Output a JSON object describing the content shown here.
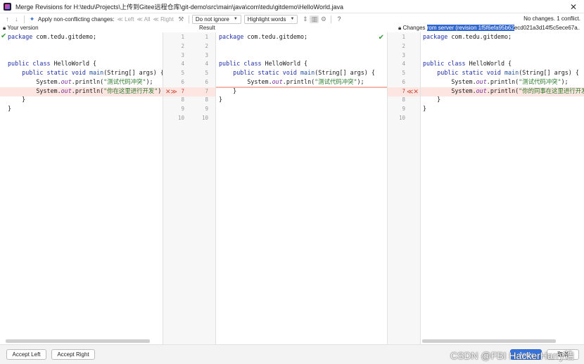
{
  "window": {
    "title": "Merge Revisions for H:\\tedu\\Projects\\上传到Gitee远程仓库\\git-demo\\src\\main\\java\\com\\tedu\\gitdemo\\HelloWorld.java",
    "app_icon": "intellij-icon",
    "close_glyph": "✕"
  },
  "toolbar": {
    "apply_nonconflicting_label": "Apply non-conflicting changes:",
    "left_label": "Left",
    "all_label": "All",
    "right_label": "Right",
    "ignore_dropdown": "Do not ignore",
    "highlight_dropdown": "Highlight words",
    "help_glyph": "?",
    "status": "No changes. 1 conflict."
  },
  "headers": {
    "left": "Your version",
    "middle": "Result",
    "right_prefix": "Changes ",
    "right_selected": "rom server (revision 1f5f6efa95b62",
    "right_rest": "ecd021a3d14f5c5ece67a..."
  },
  "line_numbers": [
    "1",
    "2",
    "3",
    "4",
    "5",
    "6",
    "7",
    "8",
    "9",
    "10"
  ],
  "code": {
    "left": [
      {
        "segs": [
          [
            "kw",
            "package"
          ],
          [
            "",
            "com.tedu.gitdemo;"
          ]
        ]
      },
      {
        "segs": []
      },
      {
        "segs": []
      },
      {
        "segs": [
          [
            "kw",
            "public"
          ],
          [
            "",
            ""
          ],
          [
            "kw",
            "class"
          ],
          [
            "",
            "HelloWorld {"
          ]
        ]
      },
      {
        "segs": [
          [
            "",
            "    "
          ],
          [
            "kw",
            "public"
          ],
          [
            "",
            ""
          ],
          [
            "kw",
            "static"
          ],
          [
            "",
            ""
          ],
          [
            "kw",
            "void"
          ],
          [
            "",
            ""
          ],
          [
            "fn",
            "main"
          ],
          [
            "",
            "(String[] args) {"
          ]
        ]
      },
      {
        "segs": [
          [
            "",
            "        System."
          ],
          [
            "itl",
            "out"
          ],
          [
            "",
            ".println("
          ],
          [
            "str",
            "\"测试代码冲突\""
          ],
          [
            "",
            ");"
          ]
        ]
      },
      {
        "segs": [
          [
            "",
            "        System."
          ],
          [
            "itl",
            "out"
          ],
          [
            "",
            ".println("
          ],
          [
            "str",
            "\"你在这里进行开发\""
          ],
          [
            "",
            ");"
          ]
        ]
      },
      {
        "segs": [
          [
            "",
            "    }"
          ]
        ]
      },
      {
        "segs": [
          [
            "",
            "}"
          ]
        ]
      }
    ],
    "middle": [
      {
        "segs": [
          [
            "kw",
            "package"
          ],
          [
            "",
            "com.tedu.gitdemo;"
          ]
        ]
      },
      {
        "segs": []
      },
      {
        "segs": []
      },
      {
        "segs": [
          [
            "kw",
            "public"
          ],
          [
            "",
            ""
          ],
          [
            "kw",
            "class"
          ],
          [
            "",
            "HelloWorld {"
          ]
        ]
      },
      {
        "segs": [
          [
            "",
            "    "
          ],
          [
            "kw",
            "public"
          ],
          [
            "",
            ""
          ],
          [
            "kw",
            "static"
          ],
          [
            "",
            ""
          ],
          [
            "kw",
            "void"
          ],
          [
            "",
            ""
          ],
          [
            "fn",
            "main"
          ],
          [
            "",
            "(String[] args) {"
          ]
        ]
      },
      {
        "segs": [
          [
            "",
            "        System."
          ],
          [
            "itl",
            "out"
          ],
          [
            "",
            ".println("
          ],
          [
            "str",
            "\"测试代码冲突\""
          ],
          [
            "",
            ");"
          ]
        ]
      },
      {
        "segs": [
          [
            "",
            "    }"
          ]
        ]
      },
      {
        "segs": [
          [
            "",
            "}"
          ]
        ]
      }
    ],
    "right": [
      {
        "segs": [
          [
            "kw",
            "package"
          ],
          [
            "",
            "com.tedu.gitdemo;"
          ]
        ]
      },
      {
        "segs": []
      },
      {
        "segs": []
      },
      {
        "segs": [
          [
            "kw",
            "public"
          ],
          [
            "",
            ""
          ],
          [
            "kw",
            "class"
          ],
          [
            "",
            "HelloWorld {"
          ]
        ]
      },
      {
        "segs": [
          [
            "",
            "    "
          ],
          [
            "kw",
            "public"
          ],
          [
            "",
            ""
          ],
          [
            "kw",
            "static"
          ],
          [
            "",
            ""
          ],
          [
            "kw",
            "void"
          ],
          [
            "",
            ""
          ],
          [
            "fn",
            "main"
          ],
          [
            "",
            "(String[] args) {"
          ]
        ]
      },
      {
        "segs": [
          [
            "",
            "        System."
          ],
          [
            "itl",
            "out"
          ],
          [
            "",
            ".println("
          ],
          [
            "str",
            "\"测试代码冲突\""
          ],
          [
            "",
            ");"
          ]
        ]
      },
      {
        "segs": [
          [
            "",
            "        System."
          ],
          [
            "itl",
            "out"
          ],
          [
            "",
            ".println("
          ],
          [
            "str",
            "\"你的同事在这里进行开发\""
          ],
          [
            "",
            ");"
          ]
        ]
      },
      {
        "segs": [
          [
            "",
            "    }"
          ]
        ]
      },
      {
        "segs": [
          [
            "",
            "}"
          ]
        ]
      }
    ]
  },
  "markers": {
    "left_actions": "✕≫",
    "right_actions": "≪✕"
  },
  "buttons": {
    "accept_left": "Accept Left",
    "accept_right": "Accept Right",
    "apply": "Apply",
    "cancel": "取消"
  },
  "watermark": "CSDN @FBI HackerHarry浩",
  "colors": {
    "conflict": "#fde5e1",
    "selection": "#2f66d0",
    "keyword": "#1f2fa8",
    "string": "#2a7a2a"
  }
}
